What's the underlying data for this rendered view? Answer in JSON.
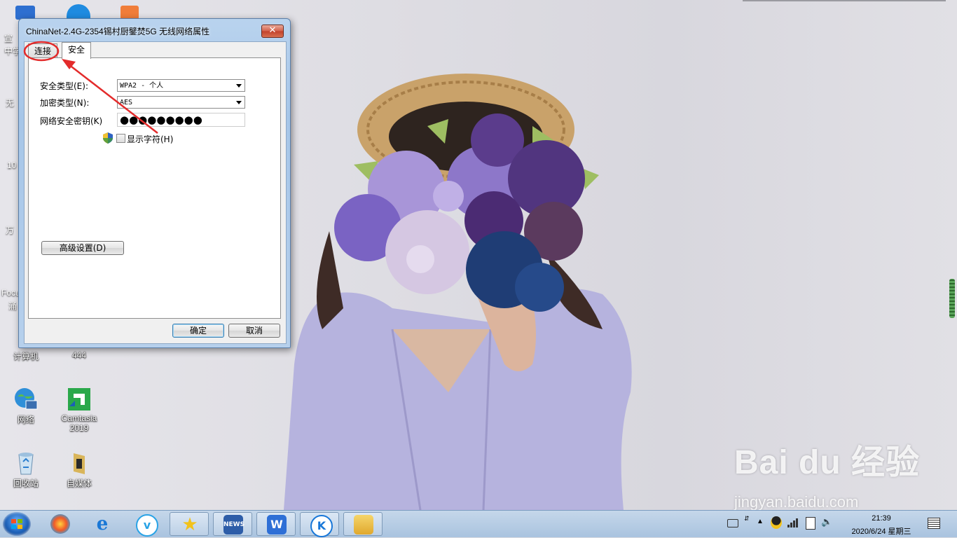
{
  "dialog": {
    "title": "ChinaNet-2.4G-2354锡村厨鐾焚5G 无线网络属性",
    "close_symbol": "✕",
    "tabs": [
      {
        "label": "连接"
      },
      {
        "label": "安全"
      }
    ],
    "security_type_label": "安全类型(E):",
    "security_type_value": "WPA2 - 个人",
    "encryption_type_label": "加密类型(N):",
    "encryption_type_value": "AES",
    "key_label": "网络安全密钥(K)",
    "key_value": "●●●●●●●●●",
    "show_chars_label": "显示字符(H)",
    "advanced_button": "高级设置(D)",
    "ok_button": "确定",
    "cancel_button": "取消"
  },
  "desktop": {
    "icons": [
      {
        "label": "计算机"
      },
      {
        "label": "444"
      },
      {
        "label": "网络"
      },
      {
        "label": "Camtasia 2019"
      },
      {
        "label": "回收站"
      },
      {
        "label": "自媒体"
      }
    ],
    "partial_labels": [
      "宣",
      "中学",
      "无",
      "10",
      "万",
      "Focu",
      "涌"
    ]
  },
  "taskbar": {
    "time": "21:39",
    "date": "2020/6/24 星期三"
  },
  "watermark": {
    "brand": "Bai du 经验",
    "url": "jingyan.baidu.com"
  },
  "colors": {
    "annotation_red": "#e32b2b",
    "dialog_frame": "#b2cdea",
    "taskbar": "#b7cde4"
  }
}
